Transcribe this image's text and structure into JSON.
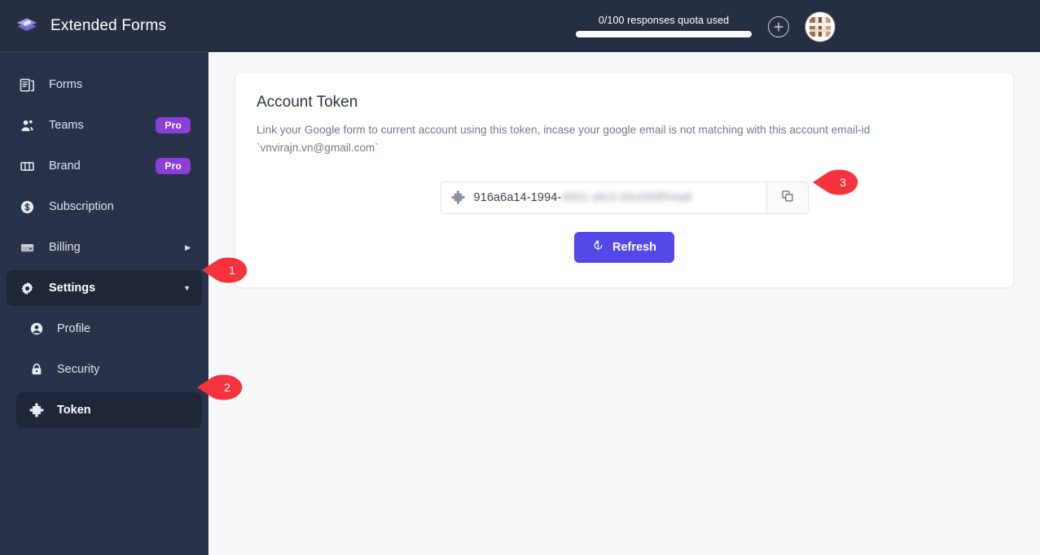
{
  "brand": {
    "title": "Extended Forms",
    "logo_icon": "layers-icon"
  },
  "header": {
    "quota_label": "0/100 responses quota used",
    "quota_percent": 0,
    "add_icon": "plus-circle-icon",
    "avatar_icon": "avatar"
  },
  "sidebar": {
    "items": [
      {
        "label": "Forms",
        "icon": "forms-icon",
        "badge": "",
        "trailing": "",
        "state": "default",
        "level": "top"
      },
      {
        "label": "Teams",
        "icon": "teams-icon",
        "badge": "Pro",
        "trailing": "",
        "state": "default",
        "level": "top"
      },
      {
        "label": "Brand",
        "icon": "brand-icon",
        "badge": "Pro",
        "trailing": "",
        "state": "default",
        "level": "top"
      },
      {
        "label": "Subscription",
        "icon": "subscription-icon",
        "badge": "",
        "trailing": "",
        "state": "default",
        "level": "top"
      },
      {
        "label": "Billing",
        "icon": "billing-icon",
        "badge": "",
        "trailing": "caret-right-icon",
        "state": "default",
        "level": "top"
      },
      {
        "label": "Settings",
        "icon": "gear-icon",
        "badge": "",
        "trailing": "caret-down-icon",
        "state": "active",
        "level": "top"
      },
      {
        "label": "Profile",
        "icon": "user-circle-icon",
        "badge": "",
        "trailing": "",
        "state": "default",
        "level": "sub"
      },
      {
        "label": "Security",
        "icon": "lock-icon",
        "badge": "",
        "trailing": "",
        "state": "default",
        "level": "sub"
      },
      {
        "label": "Token",
        "icon": "puzzle-icon",
        "badge": "",
        "trailing": "",
        "state": "active",
        "level": "sub"
      }
    ]
  },
  "main": {
    "card": {
      "title": "Account Token",
      "description": "Link your Google form to current account using this token, incase your google email is not matching with this account email-id `vnvirajn.vn@gmail.com`",
      "token": {
        "icon": "puzzle-icon",
        "visible_value": "916a6a14-1994-",
        "redacted_value": "4991-afe3-00c066ff44a8",
        "copy_icon": "copy-icon"
      },
      "refresh_button": {
        "label": "Refresh",
        "icon": "refresh-icon"
      }
    }
  },
  "callouts": [
    {
      "number": "1"
    },
    {
      "number": "2"
    },
    {
      "number": "3"
    }
  ],
  "colors": {
    "sidebar_bg": "#28324a",
    "topbar_bg": "#262f42",
    "active_nav_bg": "#1e2637",
    "pro_badge": "#8b3fd6",
    "primary_button": "#5548e8",
    "callout_red": "#f5333f",
    "content_bg": "#f7f8fa"
  }
}
